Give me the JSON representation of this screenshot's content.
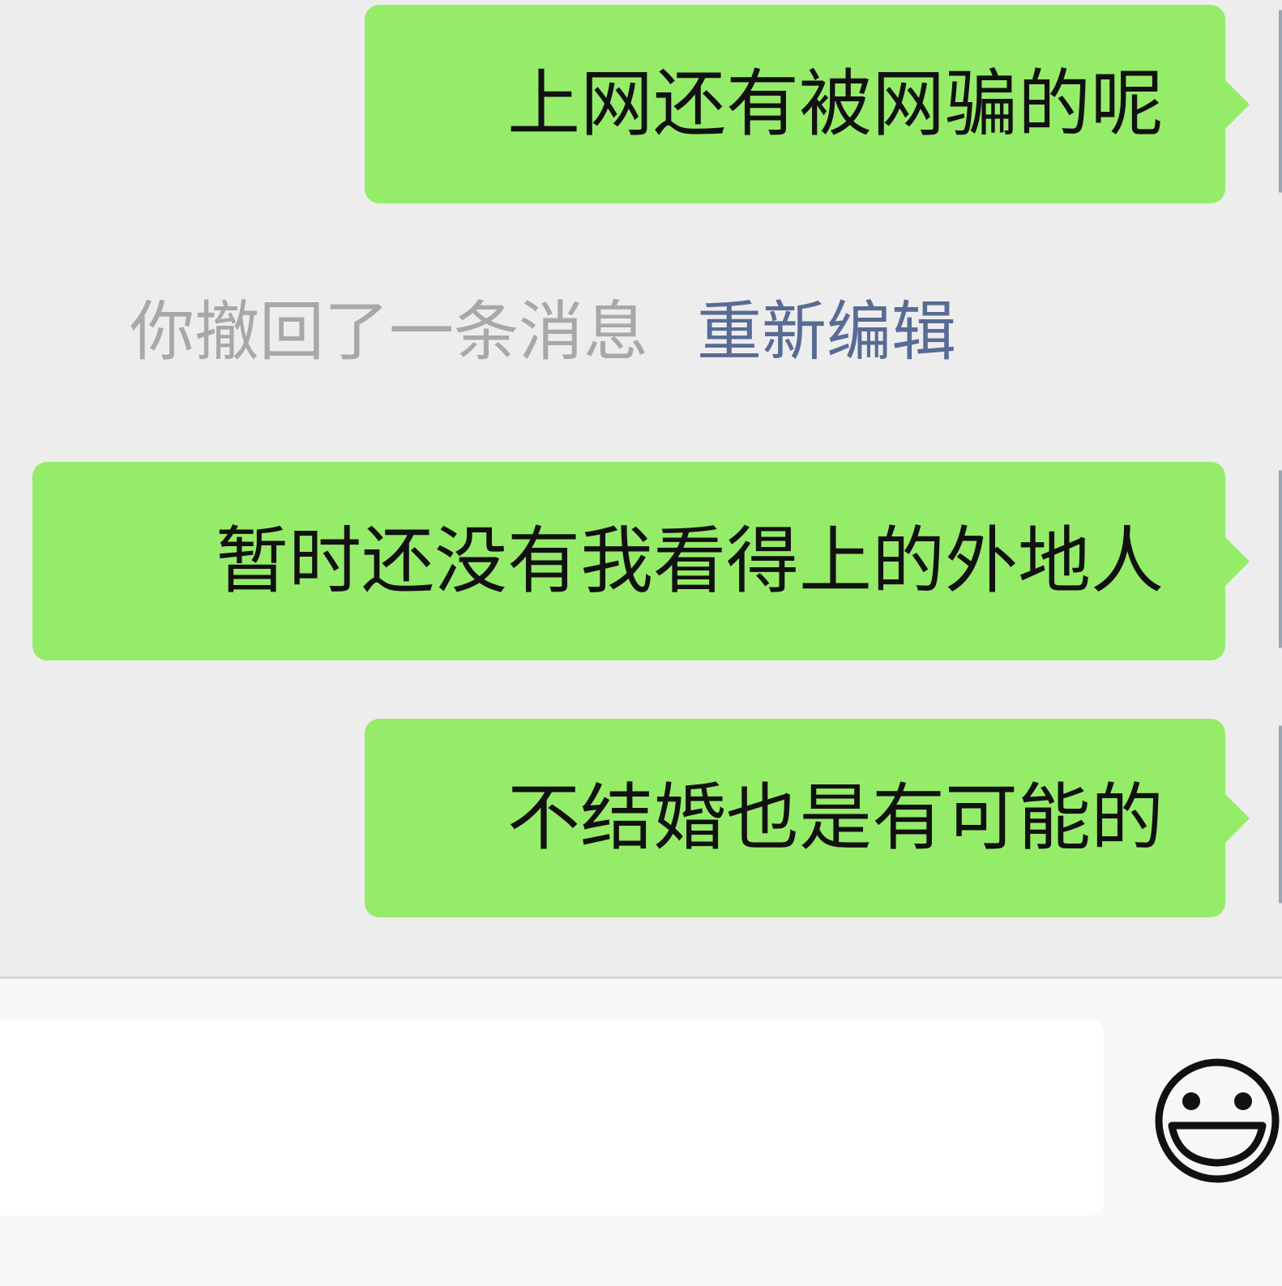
{
  "messages": [
    {
      "side": "right",
      "text": "上网还有被网骗的呢"
    },
    {
      "side": "right",
      "text": "暂时还没有我看得上的外地人"
    },
    {
      "side": "right",
      "text": "不结婚也是有可能的"
    }
  ],
  "recall_notice": {
    "text": "你撤回了一条消息",
    "action_label": "重新编辑"
  },
  "input_bar": {
    "value": "",
    "emoji_icon": "smiley-face-icon"
  },
  "colors": {
    "chat_background": "#ededed",
    "outgoing_bubble": "#95ec69",
    "recall_text": "#a8a8a8",
    "link_blue": "#576b95",
    "input_bar_background": "#f7f7f7"
  }
}
